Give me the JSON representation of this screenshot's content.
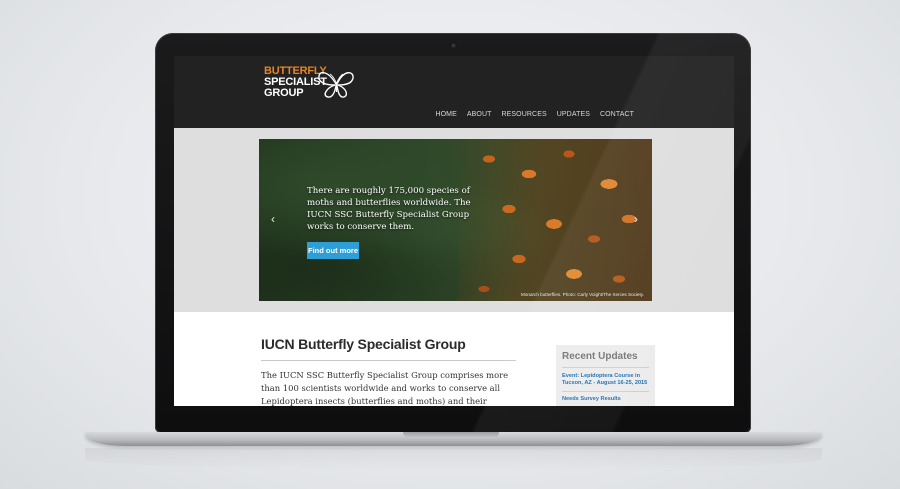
{
  "site": {
    "logo": {
      "line1": "BUTTERFLY",
      "line2": "SPECIALIST",
      "line3": "GROUP"
    },
    "nav": [
      {
        "label": "HOME"
      },
      {
        "label": "ABOUT"
      },
      {
        "label": "RESOURCES"
      },
      {
        "label": "UPDATES"
      },
      {
        "label": "CONTACT"
      }
    ],
    "hero": {
      "text": "There are roughly 175,000 species of moths and butterflies worldwide. The IUCN SSC Butterfly Specialist Group works to conserve them.",
      "button_label": "Find out more",
      "prev_arrow": "‹",
      "next_arrow": "›",
      "caption": "Monarch butterflies. Photo: Carly Voight/The Xerces Society."
    },
    "main": {
      "title": "IUCN Butterfly Specialist Group",
      "intro": "The IUCN SSC Butterfly Specialist Group comprises more than 100 scientists worldwide and works to conserve all Lepidoptera insects (butterflies and moths) and their habitats"
    },
    "sidebar": {
      "title": "Recent Updates",
      "updates": [
        {
          "label": "Event: Lepidoptera Course in Tucson, AZ - August 16-25, 2015"
        },
        {
          "label": "Needs Survey Results"
        }
      ]
    }
  },
  "colors": {
    "header_bg": "#222223",
    "logo_accent": "#e88324",
    "button_blue": "#2e9fd6",
    "link_blue": "#1f6fb2"
  },
  "icons": {
    "logo_mark": "butterfly-logo-icon",
    "prev": "chevron-left-icon",
    "next": "chevron-right-icon",
    "camera": "camera-icon"
  }
}
